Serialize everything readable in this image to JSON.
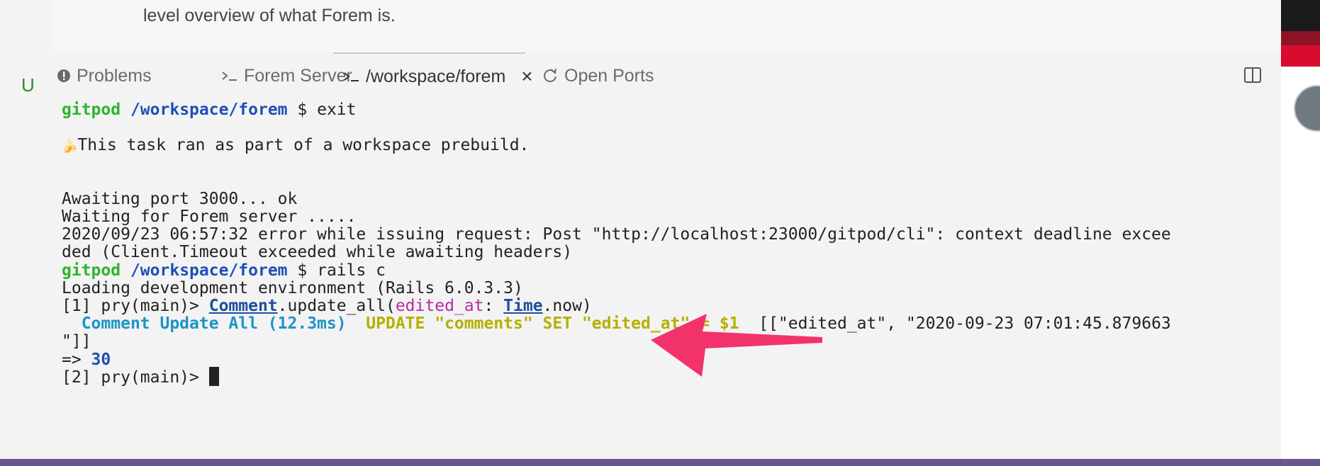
{
  "editor": {
    "preview_text": "level overview of what Forem is."
  },
  "gutter": {
    "git_status": "U"
  },
  "panel_tabs": [
    {
      "label": "Problems",
      "icon": "alert-circle-icon"
    },
    {
      "label": "Forem Server",
      "icon": "terminal-icon"
    },
    {
      "label": "/workspace/forem",
      "icon": "terminal-icon",
      "active": true,
      "close": "×"
    },
    {
      "label": "Open Ports",
      "icon": "refresh-icon"
    }
  ],
  "terminal": {
    "prompt_user": "gitpod",
    "prompt_path": "/workspace/forem",
    "prompt_symbol": "$",
    "cmd_exit": "exit",
    "banana": "🍌",
    "prebuild_msg": "This task ran as part of a workspace prebuild.",
    "awaiting": "Awaiting port 3000... ok",
    "waiting": "Waiting for Forem server .....",
    "error_1": "2020/09/23 06:57:32 error while issuing request: Post \"http://localhost:23000/gitpod/cli\": context deadline excee",
    "error_2": "ded (Client.Timeout exceeded while awaiting headers)",
    "cmd_rails": "rails c",
    "loading": "Loading development environment (Rails 6.0.3.3)",
    "pry1": "[1] pry(main)> ",
    "comment_cls": "Comment",
    "update_all": ".update_all(",
    "edited_at_arg": "edited_at",
    "colon": ": ",
    "time_cls": "Time",
    "now_call": ".now)",
    "sql_label": "Comment Update All (12.3ms)",
    "sql_query": "UPDATE \"comments\" SET \"edited_at\" = $1",
    "sql_params": "[[\"edited_at\", \"2020-09-23 07:01:45.879663",
    "sql_params_end": "\"]]",
    "result_arrow": "=> ",
    "result_value": "30",
    "pry2": "[2] pry(main)> "
  },
  "colors": {
    "annotation_arrow": "#f2336b",
    "status_bar": "#68568c"
  }
}
